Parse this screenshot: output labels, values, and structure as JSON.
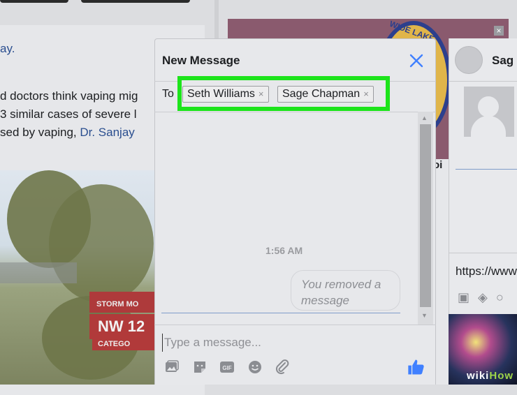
{
  "feed": {
    "line1": "ay.",
    "line2": "d doctors think vaping mig",
    "line3": "3 similar cases of severe l",
    "line4_prefix": "sed by vaping, ",
    "line4_link": "Dr. Sanjay",
    "news_tag": "STORM MO",
    "news_headline": "NW 12",
    "news_category": "CATEGO"
  },
  "ad": {
    "circle_text": "WIDE LAKE",
    "band_text": "oi"
  },
  "new_message": {
    "title": "New Message",
    "to_label": "To",
    "recipients": [
      {
        "name": "Seth Williams"
      },
      {
        "name": "Sage Chapman"
      }
    ],
    "remove_glyph": "×",
    "timestamp": "1:56 AM",
    "system_message": "You removed a message",
    "composer_placeholder": "Type a message...",
    "highlight_color": "#1de41b",
    "accent_color": "#4080ff"
  },
  "side_chat": {
    "name": "Sag",
    "url_preview": "https://www"
  },
  "watermark": {
    "wiki": "wiki",
    "how": "How"
  }
}
